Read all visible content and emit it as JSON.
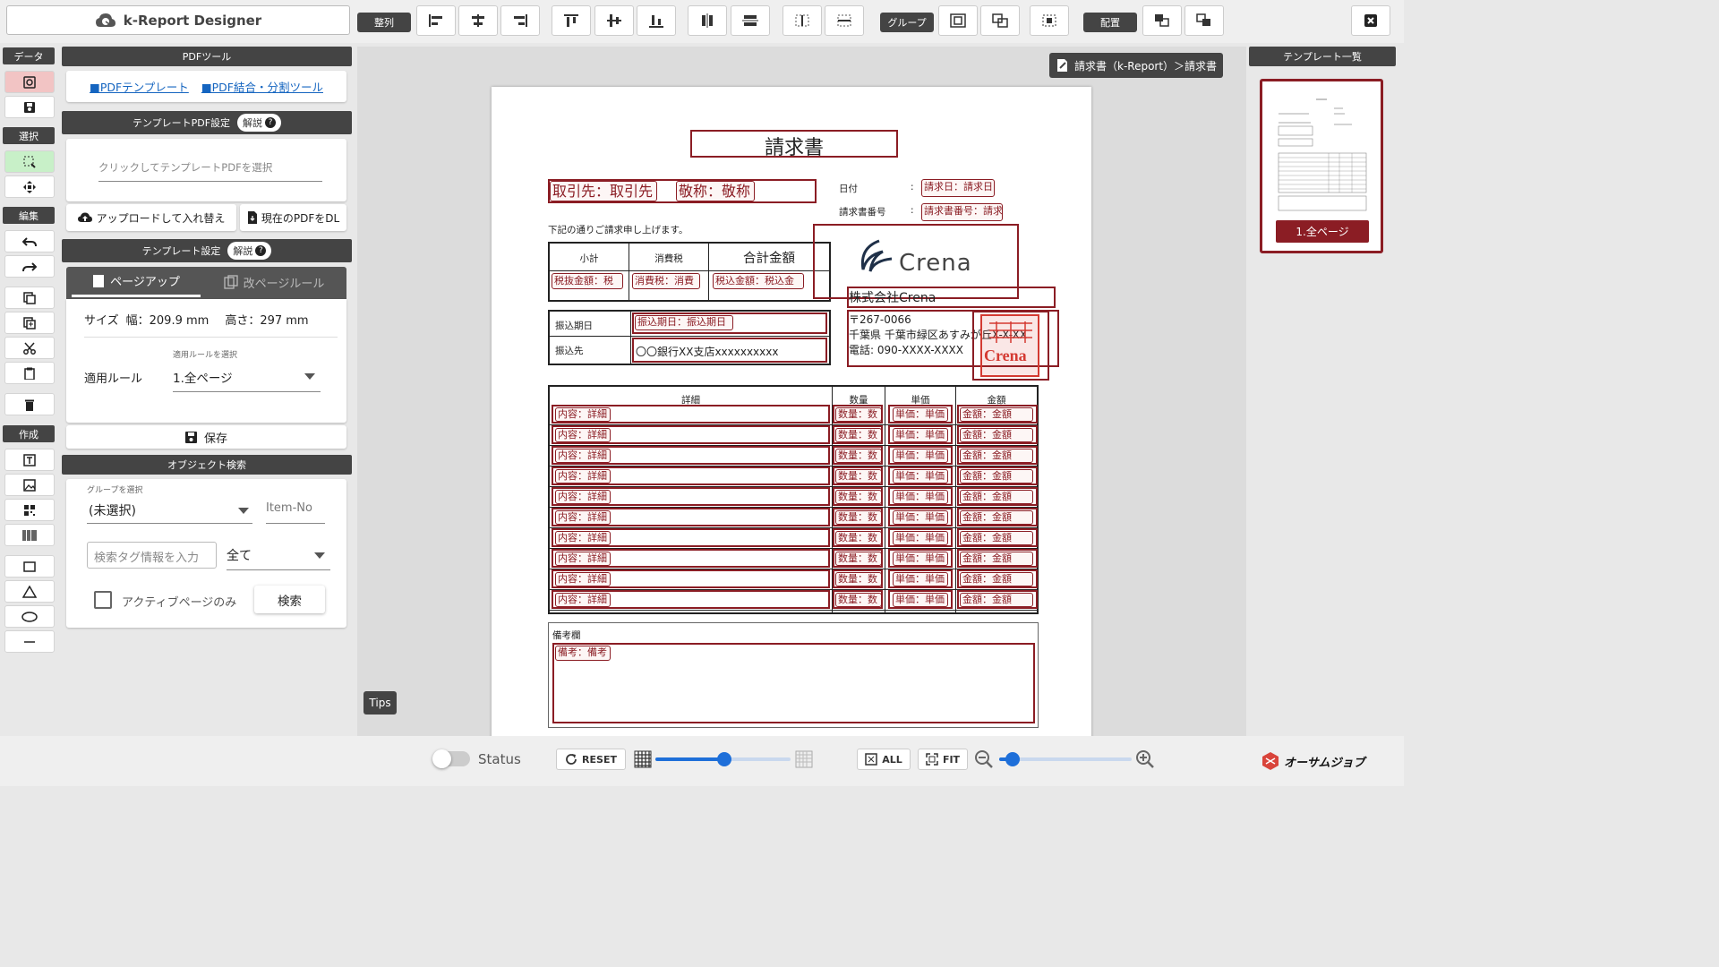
{
  "app": {
    "title": "k-Report Designer",
    "brand": "オーサムジョブ"
  },
  "colors": {
    "accent": "#8b1d24",
    "dark": "#444444",
    "link": "#1565c0",
    "slider": "#1e6fd9"
  },
  "toolbar": {
    "align_label": "整列",
    "group_label": "グループ",
    "arrange_label": "配置"
  },
  "left_column": {
    "data_label": "データ",
    "select_label": "選択",
    "edit_label": "編集",
    "create_label": "作成"
  },
  "panel": {
    "pdf_tools": {
      "header": "PDFツール",
      "link1": "■PDFテンプレート",
      "link2": "■PDF結合・分割ツール"
    },
    "template_pdf": {
      "header": "テンプレートPDF設定",
      "help": "解説",
      "placeholder": "クリックしてテンプレートPDFを選択",
      "upload_button": "アップロードして入れ替え",
      "download_button": "現在のPDFをDL"
    },
    "template_settings": {
      "header": "テンプレート設定",
      "help": "解説",
      "tab_page": "ページアップ",
      "tab_rule": "改ページルール",
      "size_label": "サイズ",
      "width_label": "幅：209.9 mm",
      "height_label": "高さ：297 mm",
      "rule_caption": "適用ルールを選択",
      "rule_label": "適用ルール",
      "rule_value": "1.全ページ",
      "save_button": "保存"
    },
    "object_search": {
      "header": "オブジェクト検索",
      "group_caption": "グループを選択",
      "group_value": "(未選択)",
      "item_no_placeholder": "Item-No",
      "tag_placeholder": "検索タグ情報を入力",
      "scope_value": "全て",
      "active_only_label": "アクティブページのみ",
      "search_button": "検索"
    }
  },
  "canvas": {
    "breadcrumb": "請求書（k-Report）＞請求書",
    "tips": "Tips"
  },
  "invoice": {
    "title": "請求書",
    "client_field": "取引先：取引先",
    "honorific_field": "敬称：敬称",
    "date_label": "日付",
    "date_field": "請求日：請求日",
    "number_label": "請求書番号",
    "number_field": "請求書番号：請求",
    "colon": ":",
    "intro": "下記の通りご請求申し上げます。",
    "subtotal_header": "小計",
    "tax_header": "消費税",
    "total_header": "合計金額",
    "subtotal_field": "税抜金額：税",
    "tax_field": "消費税：消費",
    "total_field": "税込金額：税込金",
    "due_label": "振込期日",
    "due_field": "振込期日：振込期日",
    "bank_label": "振込先",
    "bank_value": "〇〇銀行XX支店xxxxxxxxxx",
    "logo_text": "Crena",
    "company": "株式会社Crena",
    "postal": "〒267-0066",
    "address": "千葉県 千葉市緑区あすみが丘X-X-XX",
    "phone": "電話: 090-XXXX-XXXX",
    "stamp_text": "Crena",
    "detail_header": "詳細",
    "qty_header": "数量",
    "price_header": "単価",
    "amount_header": "金額",
    "rows": [
      {
        "detail": "内容：詳細",
        "qty": "数量：数",
        "price": "単価：単価",
        "amount": "金額：金額"
      },
      {
        "detail": "内容：詳細",
        "qty": "数量：数",
        "price": "単価：単価",
        "amount": "金額：金額"
      },
      {
        "detail": "内容：詳細",
        "qty": "数量：数",
        "price": "単価：単価",
        "amount": "金額：金額"
      },
      {
        "detail": "内容：詳細",
        "qty": "数量：数",
        "price": "単価：単価",
        "amount": "金額：金額"
      },
      {
        "detail": "内容：詳細",
        "qty": "数量：数",
        "price": "単価：単価",
        "amount": "金額：金額"
      },
      {
        "detail": "内容：詳細",
        "qty": "数量：数",
        "price": "単価：単価",
        "amount": "金額：金額"
      },
      {
        "detail": "内容：詳細",
        "qty": "数量：数",
        "price": "単価：単価",
        "amount": "金額：金額"
      },
      {
        "detail": "内容：詳細",
        "qty": "数量：数",
        "price": "単価：単価",
        "amount": "金額：金額"
      },
      {
        "detail": "内容：詳細",
        "qty": "数量：数",
        "price": "単価：単価",
        "amount": "金額：金額"
      },
      {
        "detail": "内容：詳細",
        "qty": "数量：数",
        "price": "単価：単価",
        "amount": "金額：金額"
      }
    ],
    "remarks_label": "備考欄",
    "remarks_field": "備考：備考"
  },
  "template_list": {
    "header": "テンプレート一覧",
    "page_button": "1.全ページ"
  },
  "bottom": {
    "status_label": "Status",
    "reset_label": "RESET",
    "all_label": "ALL",
    "fit_label": "FIT",
    "opacity_level": 0.51,
    "zoom_level": 0.1
  }
}
